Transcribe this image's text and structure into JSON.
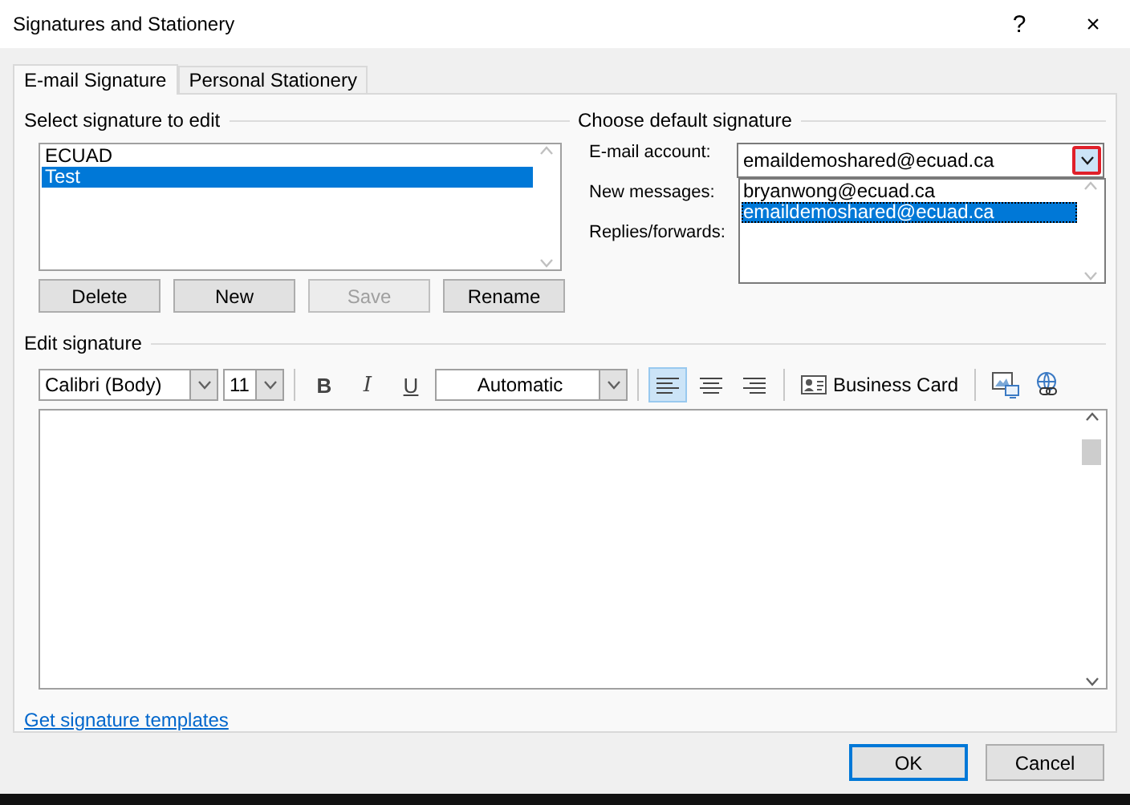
{
  "window": {
    "title": "Signatures and Stationery",
    "help": "?",
    "close": "×"
  },
  "tabs": [
    {
      "label": "E-mail Signature",
      "selected": true
    },
    {
      "label": "Personal Stationery",
      "selected": false
    }
  ],
  "select_signature": {
    "heading": "Select signature to edit",
    "items": [
      {
        "label": "ECUAD",
        "selected": false
      },
      {
        "label": "Test",
        "selected": true
      }
    ],
    "buttons": [
      {
        "label": "Delete",
        "disabled": false
      },
      {
        "label": "New",
        "disabled": false
      },
      {
        "label": "Save",
        "disabled": true
      },
      {
        "label": "Rename",
        "disabled": false
      }
    ]
  },
  "default_signature": {
    "heading": "Choose default signature",
    "fields": [
      {
        "label": "E-mail account:"
      },
      {
        "label": "New messages:"
      },
      {
        "label": "Replies/forwards:"
      }
    ],
    "account_value": "emaildemoshared@ecuad.ca",
    "dropdown": {
      "expanded": true,
      "options": [
        {
          "label": "bryanwong@ecuad.ca",
          "selected": false
        },
        {
          "label": "emaildemoshared@ecuad.ca",
          "selected": true
        }
      ]
    }
  },
  "edit_signature": {
    "heading": "Edit signature",
    "font": "Calibri (Body)",
    "size": "11",
    "font_color_label": "Automatic",
    "format_buttons": [
      {
        "label": "B",
        "kind": "bold"
      },
      {
        "label": "I",
        "kind": "italic"
      },
      {
        "label": "U",
        "kind": "underline"
      }
    ],
    "align_buttons": [
      {
        "kind": "left",
        "selected": true
      },
      {
        "kind": "center",
        "selected": false
      },
      {
        "kind": "right",
        "selected": false
      }
    ],
    "business_card": "Business Card"
  },
  "templates_link": "Get signature templates",
  "buttons": [
    {
      "label": "OK",
      "default": true
    },
    {
      "label": "Cancel",
      "default": false
    }
  ]
}
